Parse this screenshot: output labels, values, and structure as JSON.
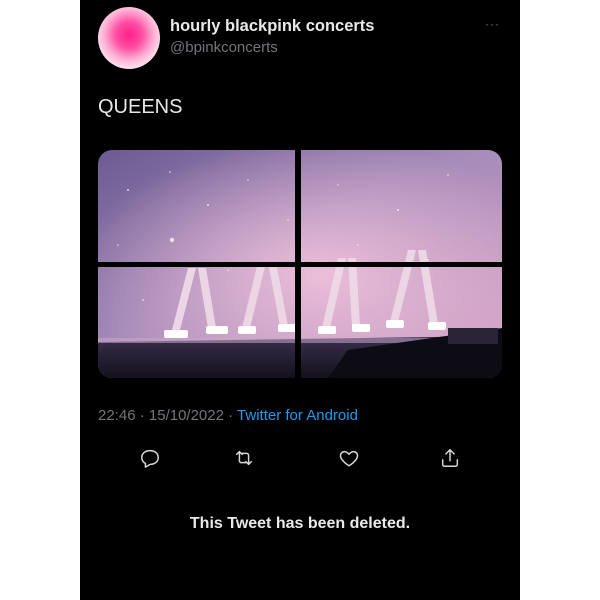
{
  "profile": {
    "display_name": "hourly blackpink concerts",
    "handle": "@bpinkconcerts"
  },
  "more_label": "···",
  "tweet": {
    "text": "QUEENS",
    "time": "22:46",
    "separator": " · ",
    "date": "15/10/2022",
    "separator2": " · ",
    "source": "Twitter for Android"
  },
  "actions": [
    "reply-icon",
    "retweet-icon",
    "like-icon",
    "share-icon"
  ],
  "deleted_notice": "This Tweet has been deleted.",
  "colors": {
    "background": "#000000",
    "text_primary": "#e7e9ea",
    "text_secondary": "#71767b",
    "link": "#1d9bf0"
  }
}
